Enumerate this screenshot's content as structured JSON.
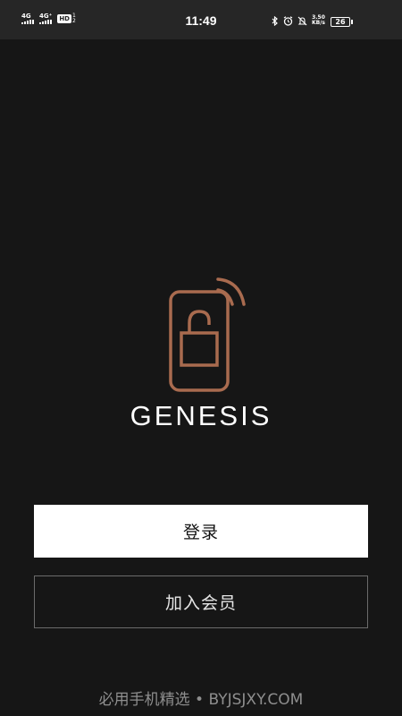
{
  "status_bar": {
    "sim1": "4G",
    "sim2": "4G⁺",
    "hd": "HD",
    "hd_sub_top": "1",
    "hd_sub_bottom": "2",
    "time": "11:49",
    "speed_value": "3.50",
    "speed_unit": "KB/s",
    "battery": "26"
  },
  "brand": {
    "name": "GENESIS",
    "logo_icon": "phone-unlock-wireless-icon",
    "accent_color": "#a96b4f"
  },
  "actions": {
    "login_label": "登录",
    "join_label": "加入会员"
  },
  "footer": {
    "text": "必用手机精选 • BYJSJXY.COM"
  },
  "colors": {
    "background": "#161616",
    "status_bar": "#262626",
    "primary_button": "#ffffff",
    "secondary_border": "#6b6b6b"
  }
}
